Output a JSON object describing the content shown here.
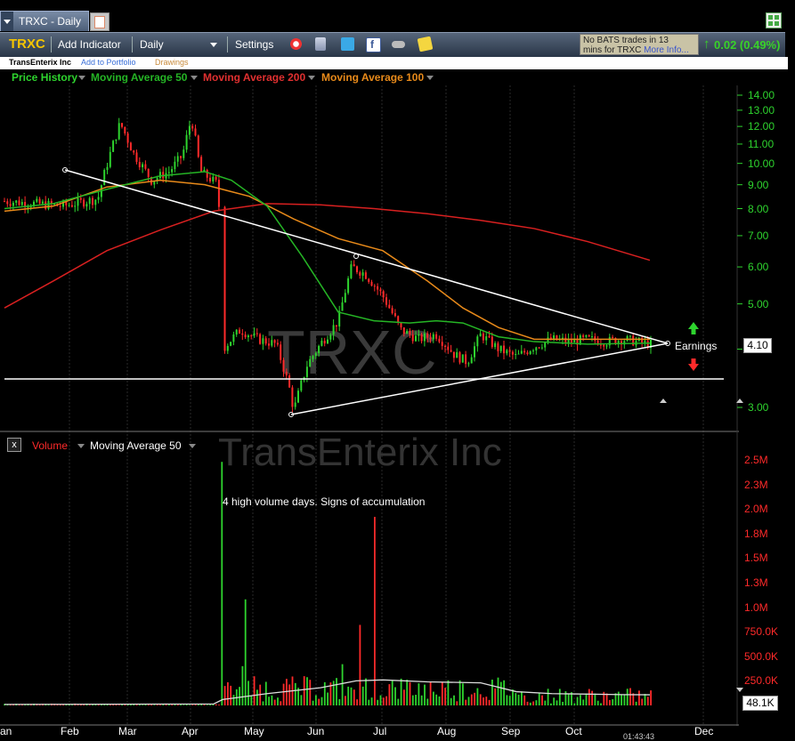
{
  "tab": {
    "title": "TRXC - Daily"
  },
  "toolbar": {
    "symbol": "TRXC",
    "add_indicator": "Add Indicator",
    "interval": "Daily",
    "settings": "Settings"
  },
  "subbar": {
    "company": "TransEnterix Inc",
    "add_portfolio": "Add to Portfolio",
    "drawings": "Drawings"
  },
  "bats_notice": {
    "line1": "No BATS trades in 13",
    "line2": "mins for TRXC",
    "more": "More Info..."
  },
  "change": "0.02 (0.49%)",
  "legend": {
    "price_history": "Price History",
    "ma50": "Moving Average 50",
    "ma200": "Moving Average 200",
    "ma100": "Moving Average 100"
  },
  "watermark": {
    "symbol": "TRXC",
    "company": "TransEnterix Inc"
  },
  "annotations": {
    "earnings": "Earnings",
    "volume_note": "4 high volume days. Signs of accumulation"
  },
  "price_label": "4.10",
  "volume_label": "48.1K",
  "volume_header": {
    "volume": "Volume",
    "ma50": "Moving Average 50"
  },
  "time_label": "01:43:43",
  "colors": {
    "up": "#2ed42e",
    "down": "#ff2a2a",
    "ma50": "#25b525",
    "ma100": "#e88a1a",
    "ma200": "#d82020",
    "toolbar": "#3a4a60"
  },
  "icons": [
    "alarm-icon",
    "stack-icon",
    "twitter-icon",
    "facebook-icon",
    "glasses-icon",
    "note-icon"
  ],
  "chart_data": [
    {
      "type": "candlestick",
      "title": "TRXC - Daily",
      "x_labels": [
        "an",
        "Feb",
        "Mar",
        "Apr",
        "May",
        "Jun",
        "Jul",
        "Aug",
        "Sep",
        "Oct",
        "Dec"
      ],
      "y_ticks": [
        "14.00",
        "13.00",
        "12.00",
        "11.00",
        "10.00",
        "9.00",
        "8.00",
        "7.00",
        "6.00",
        "5.00",
        "4.00",
        "3.00"
      ],
      "scale": "log",
      "ylim": [
        2.8,
        14.8
      ],
      "series": [
        {
          "name": "Moving Average 50",
          "values_note": "smoothed"
        },
        {
          "name": "Moving Average 100"
        },
        {
          "name": "Moving Average 200"
        }
      ],
      "last_price": 4.1
    },
    {
      "type": "bar",
      "title": "Volume",
      "y_ticks": [
        "2.5M",
        "2.3M",
        "2.0M",
        "1.8M",
        "1.5M",
        "1.3M",
        "1.0M",
        "750.0K",
        "500.0K",
        "250.0K"
      ],
      "ylim": [
        0,
        2500000
      ],
      "last_volume": "48.1K"
    }
  ]
}
